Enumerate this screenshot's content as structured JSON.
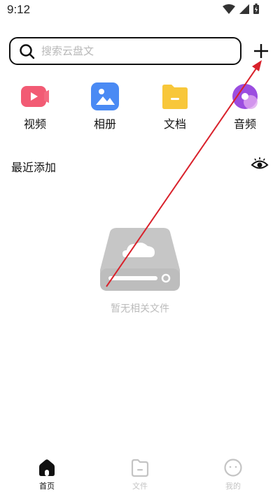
{
  "status_bar": {
    "time": "9:12"
  },
  "search": {
    "placeholder": "搜索云盘文"
  },
  "categories": [
    {
      "label": "视频",
      "icon": "video-icon",
      "color": "#f25b74"
    },
    {
      "label": "相册",
      "icon": "photo-album-icon",
      "color": "#4a8af4"
    },
    {
      "label": "文档",
      "icon": "document-folder-icon",
      "color": "#f8c73a"
    },
    {
      "label": "音频",
      "icon": "audio-icon",
      "color": "#9b4de0"
    }
  ],
  "recent": {
    "title": "最近添加",
    "toggle_icon": "eye-icon"
  },
  "empty_state": {
    "text": "暂无相关文件",
    "icon": "cloud-drive-icon"
  },
  "nav": [
    {
      "label": "首页",
      "icon": "home-icon",
      "active": true
    },
    {
      "label": "文件",
      "icon": "file-folder-icon",
      "active": false
    },
    {
      "label": "我的",
      "icon": "profile-icon",
      "active": false
    }
  ],
  "colors": {
    "accent": "#111111",
    "annotation": "#d9212b",
    "muted": "#bbbbbb"
  }
}
